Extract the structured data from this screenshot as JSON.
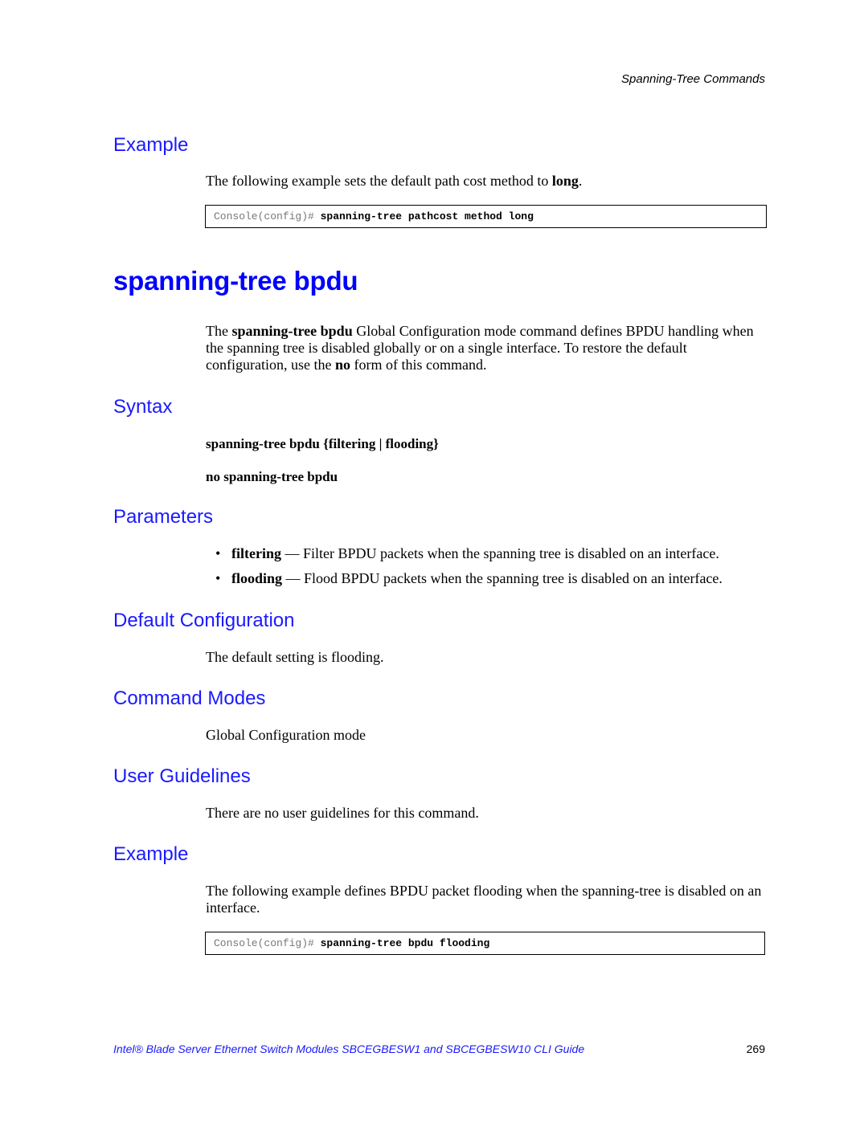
{
  "running_head": "Spanning-Tree Commands",
  "example_top": {
    "heading": "Example",
    "text_prefix": "The following example sets the default path cost method to ",
    "text_bold": "long",
    "text_suffix": ".",
    "code": {
      "prompt": "Console(config)# ",
      "command": "spanning-tree pathcost method long"
    }
  },
  "command_title": "spanning-tree bpdu",
  "description": {
    "part1": "The ",
    "bold1": "spanning-tree bpdu",
    "part2": " Global Configuration mode command defines BPDU handling when the spanning tree is disabled globally or on a single interface. To restore the default configuration, use the ",
    "bold2": "no",
    "part3": " form of this command."
  },
  "syntax": {
    "heading": "Syntax",
    "line1": "spanning-tree bpdu {filtering | flooding}",
    "line2": "no spanning-tree bpdu"
  },
  "parameters": {
    "heading": "Parameters",
    "items": [
      {
        "bullet": "•",
        "term": "filtering",
        "desc": " — Filter BPDU packets when the spanning tree is disabled on an interface."
      },
      {
        "bullet": "•",
        "term": "flooding",
        "desc": " — Flood BPDU packets when the spanning tree is disabled on an interface."
      }
    ]
  },
  "default_configuration": {
    "heading": "Default Configuration",
    "text": "The default setting is flooding."
  },
  "command_modes": {
    "heading": "Command Modes",
    "text": "Global Configuration mode"
  },
  "user_guidelines": {
    "heading": "User Guidelines",
    "text": "There are no user guidelines for this command."
  },
  "example_bottom": {
    "heading": "Example",
    "text": "The following example defines BPDU packet flooding when the spanning-tree is disabled on an interface.",
    "code": {
      "prompt": "Console(config)# ",
      "command": "spanning-tree bpdu flooding"
    }
  },
  "footer": {
    "title": "Intel® Blade Server Ethernet Switch Modules SBCEGBESW1 and SBCEGBESW10 CLI Guide",
    "page_number": "269"
  }
}
